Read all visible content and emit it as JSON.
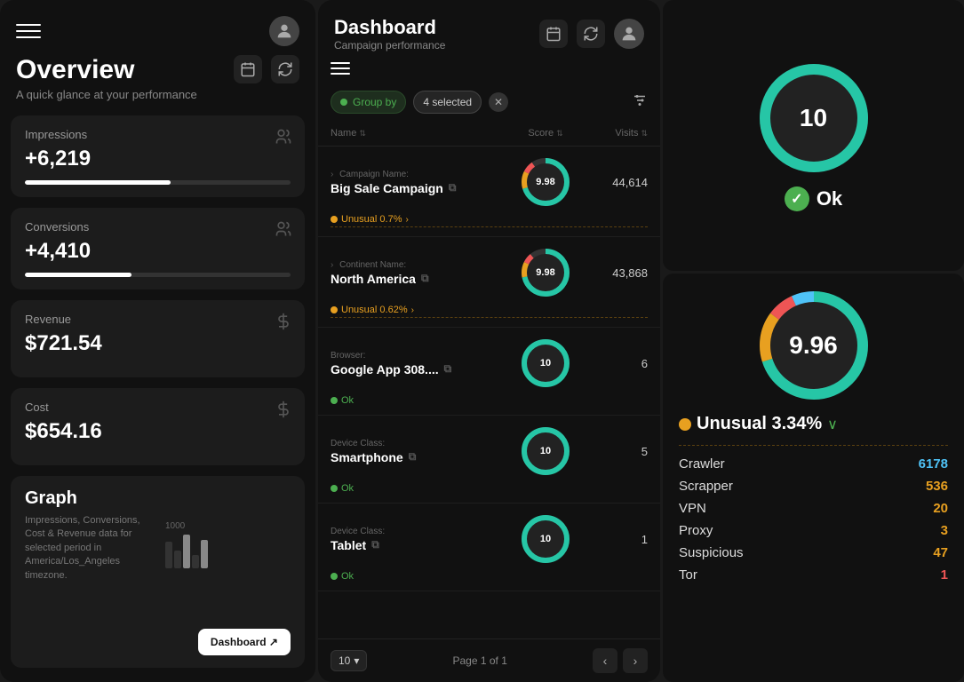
{
  "left": {
    "title": "Overview",
    "subtitle": "A quick glance at your performance",
    "metrics": [
      {
        "label": "Impressions",
        "value": "+6,219",
        "bar_width": "55"
      },
      {
        "label": "Conversions",
        "value": "+4,410",
        "bar_width": "40"
      },
      {
        "label": "Revenue",
        "value": "$721.54",
        "bar_width": null
      },
      {
        "label": "Cost",
        "value": "$654.16",
        "bar_width": null
      }
    ],
    "graph": {
      "title": "Graph",
      "desc": "Impressions, Conversions, Cost & Revenue data for selected period in America/Los_Angeles timezone.",
      "y_label": "1000",
      "dashboard_link": "Dashboard ↗"
    }
  },
  "middle": {
    "title": "Dashboard",
    "subtitle": "Campaign performance",
    "group_by_label": "Group by",
    "selected_count": "4 selected",
    "columns": {
      "name": "Name",
      "score": "Score",
      "visits": "Visits"
    },
    "rows": [
      {
        "category_label": "Campaign Name:",
        "name": "Big Sale Campaign",
        "score": "9.98",
        "score_type": "multi",
        "visits": "44,614",
        "anomaly_label": "Unusual 0.7%",
        "anomaly_type": "unusual"
      },
      {
        "category_label": "Continent Name:",
        "name": "North America",
        "score": "9.98",
        "score_type": "multi",
        "visits": "43,868",
        "anomaly_label": "Unusual 0.62%",
        "anomaly_type": "unusual"
      },
      {
        "category_label": "Browser:",
        "name": "Google App 308....",
        "score": "10",
        "score_type": "green",
        "visits": "6",
        "anomaly_label": "Ok",
        "anomaly_type": "ok"
      },
      {
        "category_label": "Device Class:",
        "name": "Smartphone",
        "score": "10",
        "score_type": "green",
        "visits": "5",
        "anomaly_label": "Ok",
        "anomaly_type": "ok"
      },
      {
        "category_label": "Device Class:",
        "name": "Tablet",
        "score": "10",
        "score_type": "green",
        "visits": "1",
        "anomaly_label": "Ok",
        "anomaly_type": "ok"
      }
    ],
    "footer": {
      "page_size": "10",
      "page_info": "Page 1 of 1"
    }
  },
  "right_top": {
    "score": "10",
    "status": "Ok"
  },
  "right_bottom": {
    "score": "9.96",
    "anomaly_pct": "Unusual 3.34%",
    "items": [
      {
        "name": "Crawler",
        "value": "6178",
        "color": "#4fc3f7"
      },
      {
        "name": "Scrapper",
        "value": "536",
        "color": "#e8a020"
      },
      {
        "name": "VPN",
        "value": "20",
        "color": "#e8a020"
      },
      {
        "name": "Proxy",
        "value": "3",
        "color": "#e8a020"
      },
      {
        "name": "Suspicious",
        "value": "47",
        "color": "#e8a020"
      },
      {
        "name": "Tor",
        "value": "1",
        "color": "#e55"
      }
    ]
  },
  "icons": {
    "hamburger": "☰",
    "calendar": "📅",
    "refresh": "↻",
    "users": "👥",
    "dollar": "$",
    "copy": "⧉",
    "chevron_down": "›",
    "filter": "⊞",
    "arrow_left": "‹",
    "arrow_right": "›",
    "check": "✓",
    "x": "✕"
  },
  "colors": {
    "green": "#4caf50",
    "orange": "#e8a020",
    "teal": "#26c6a6",
    "red": "#e55",
    "blue": "#4fc3f7",
    "bg_dark": "#111",
    "bg_card": "#1c1c1c"
  }
}
